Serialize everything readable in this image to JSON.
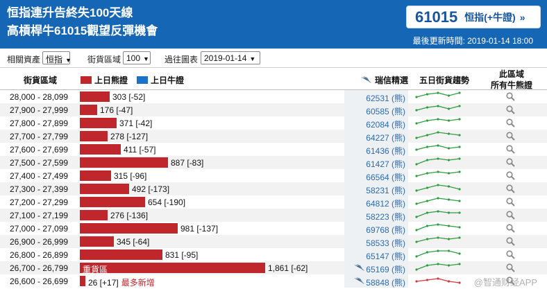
{
  "header": {
    "title_line1": "恒指連升告終失100天線",
    "title_line2": "高槓桿牛61015觀望反彈機會",
    "cta_code": "61015",
    "cta_label": "恒指(+牛證)",
    "cta_arrow": "»",
    "updated_label": "最後更新時間:",
    "updated_value": "2019-01-14 18:00"
  },
  "filters": {
    "asset_label": "相關資產",
    "asset_value": "恒指",
    "zone_label": "街貨區域",
    "zone_value": "100",
    "chart_label": "過往圖表",
    "chart_value": "2019-01-14"
  },
  "table_header": {
    "range": "街貨區域",
    "bear_legend": "上日熊證",
    "bull_legend": "上日牛證",
    "ubs": "瑞信精選",
    "trend": "五日街貨趨勢",
    "all_line1": "此區域",
    "all_line2": "所有牛熊證"
  },
  "colors": {
    "header_bg": "#1566b4",
    "bear": "#c0272d",
    "bull": "#1a73c8",
    "trend_up": "#2e9e3e",
    "trend_down": "#d9363e"
  },
  "icons": {
    "ubs": "ubs-logo-icon",
    "search": "magnifier-icon"
  },
  "rows": [
    {
      "range": "28,000 - 28,099",
      "value": 303,
      "label": "303 [-52]",
      "code": "62531 (熊)",
      "trend": [
        3,
        5,
        6,
        4,
        6
      ],
      "dir": "up"
    },
    {
      "range": "27,900 - 27,999",
      "value": 176,
      "label": "176 [-47]",
      "code": "60585 (熊)",
      "trend": [
        3,
        5,
        6,
        4,
        6
      ],
      "dir": "up"
    },
    {
      "range": "27,800 - 27,899",
      "value": 371,
      "label": "371 [-42]",
      "code": "62084 (熊)",
      "trend": [
        3,
        5,
        6,
        5,
        6
      ],
      "dir": "up"
    },
    {
      "range": "27,700 - 27,799",
      "value": 278,
      "label": "278 [-127]",
      "code": "64227 (熊)",
      "trend": [
        2,
        4,
        6,
        5,
        4
      ],
      "dir": "up"
    },
    {
      "range": "27,600 - 27,699",
      "value": 411,
      "label": "411 [-57]",
      "code": "61436 (熊)",
      "trend": [
        3,
        5,
        6,
        4,
        5
      ],
      "dir": "up"
    },
    {
      "range": "27,500 - 27,599",
      "value": 887,
      "label": "887 [-83]",
      "code": "61427 (熊)",
      "trend": [
        2,
        5,
        6,
        5,
        6
      ],
      "dir": "up"
    },
    {
      "range": "27,400 - 27,499",
      "value": 315,
      "label": "315 [-96]",
      "code": "66564 (熊)",
      "trend": [
        3,
        5,
        6,
        5,
        6
      ],
      "dir": "up"
    },
    {
      "range": "27,300 - 27,399",
      "value": 492,
      "label": "492 [-173]",
      "code": "58231 (熊)",
      "trend": [
        2,
        4,
        6,
        5,
        3
      ],
      "dir": "up"
    },
    {
      "range": "27,200 - 27,299",
      "value": 654,
      "label": "654 [-190]",
      "code": "64812 (熊)",
      "trend": [
        2,
        4,
        6,
        5,
        4
      ],
      "dir": "up"
    },
    {
      "range": "27,100 - 27,199",
      "value": 276,
      "label": "276 [-136]",
      "code": "58223 (熊)",
      "trend": [
        2,
        5,
        6,
        5,
        5
      ],
      "dir": "up"
    },
    {
      "range": "27,000 - 27,099",
      "value": 981,
      "label": "981 [-137]",
      "code": "69768 (熊)",
      "trend": [
        2,
        5,
        6,
        5,
        4
      ],
      "dir": "up"
    },
    {
      "range": "26,900 - 26,999",
      "value": 345,
      "label": "345 [-64]",
      "code": "58533 (熊)",
      "trend": [
        3,
        5,
        6,
        5,
        6
      ],
      "dir": "up"
    },
    {
      "range": "26,800 - 26,899",
      "value": 831,
      "label": "831 [-95]",
      "code": "65147 (熊)",
      "trend": [
        2,
        5,
        6,
        6,
        4
      ],
      "dir": "up"
    },
    {
      "range": "26,700 - 26,799",
      "value": 1861,
      "label": "1,861 [-62]",
      "inner": "重貨區",
      "code": "65169 (熊)",
      "ubs": true,
      "trend": [
        2,
        5,
        6,
        5,
        6
      ],
      "dir": "up"
    },
    {
      "range": "26,600 - 26,699",
      "value": 26,
      "label": "26 [+17]",
      "note": "最多新增",
      "code": "58848 (熊)",
      "ubs": true,
      "trend": [
        3,
        4,
        5,
        3,
        2
      ],
      "dir": "down"
    }
  ],
  "watermark": "@智通财经APP"
}
